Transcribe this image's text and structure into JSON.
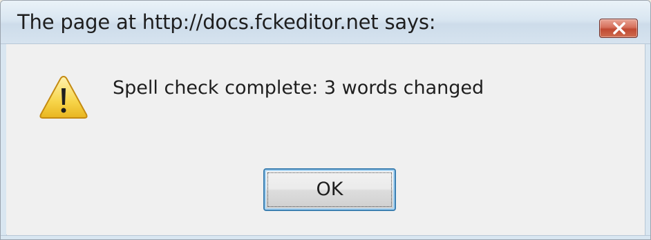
{
  "dialog": {
    "title": "The page at http://docs.fckeditor.net says:",
    "message": "Spell check complete: 3 words changed",
    "ok_label": "OK",
    "icon": "warning-icon",
    "close_icon": "close-icon"
  },
  "colors": {
    "title_bar": "#d9e6f1",
    "body": "#f0f0f0",
    "close_button": "#c04a32",
    "focus_border": "#3c7fb1",
    "warning_fill": "#f7d54a"
  }
}
